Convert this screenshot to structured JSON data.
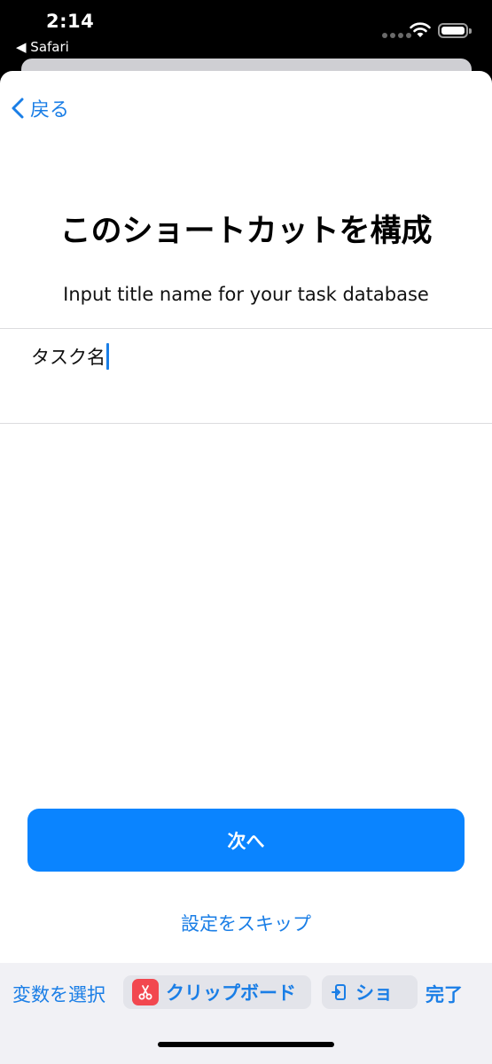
{
  "status_bar": {
    "time": "2:14",
    "back_app": "◀ Safari"
  },
  "nav": {
    "back_label": "戻る"
  },
  "main": {
    "title": "このショートカットを構成",
    "subtitle": "Input title name for your task database",
    "input_value": "タスク名",
    "next_button": "次へ",
    "skip_link": "設定をスキップ"
  },
  "toolbar": {
    "select_variable": "変数を選択",
    "clipboard_chip": "クリップボード",
    "shortcut_chip": "ショ",
    "done": "完了"
  },
  "colors": {
    "accent": "#1a7ee6",
    "button": "#0a84ff",
    "clipboard_icon_bg": "#f2474f"
  },
  "icons": [
    "chevron-left-icon",
    "wifi-icon",
    "battery-icon",
    "scissors-icon",
    "shortcut-input-icon"
  ]
}
